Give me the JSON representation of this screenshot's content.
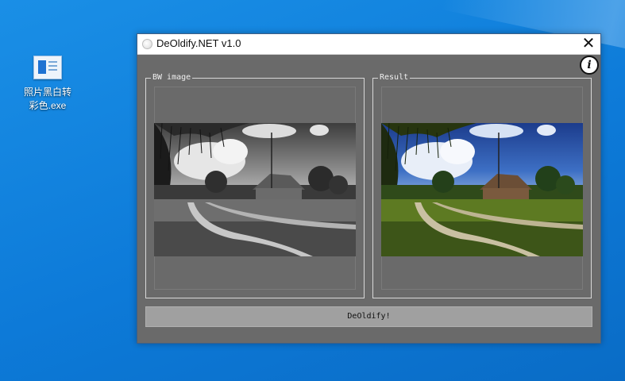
{
  "desktop": {
    "icon_label_line1": "照片黑白转",
    "icon_label_line2": "彩色.exe",
    "icon": "app-window-icon"
  },
  "window": {
    "title": "DeOldify.NET v1.0",
    "app_icon": "app-circle-icon",
    "close_glyph": "✕",
    "info_glyph": "i"
  },
  "panels": {
    "bw_label": "BW image",
    "result_label": "Result"
  },
  "action": {
    "button_label": "DeOldify!"
  },
  "colors": {
    "window_bg": "#6a6a6a",
    "button_bg": "#a0a0a0",
    "desktop_bg": "#0d7ad8"
  }
}
